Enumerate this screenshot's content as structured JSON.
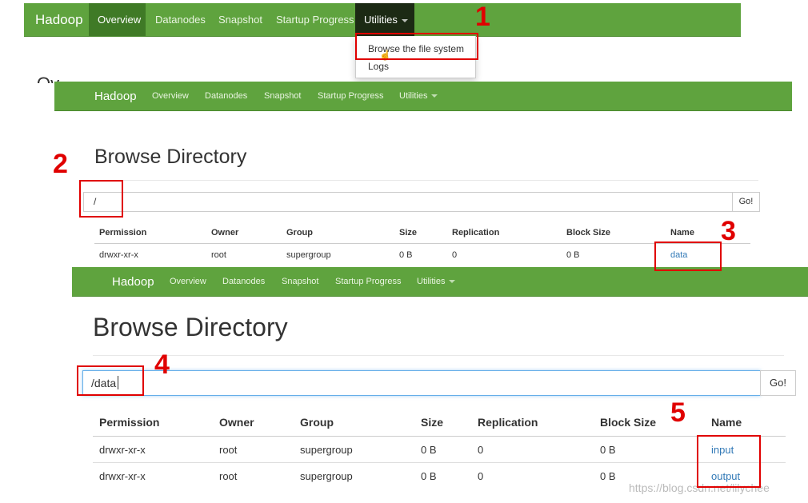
{
  "nav": {
    "brand": "Hadoop",
    "items": [
      "Overview",
      "Datanodes",
      "Snapshot",
      "Startup Progress",
      "Utilities"
    ]
  },
  "dropdown": {
    "items": [
      "Browse the file system",
      "Logs"
    ]
  },
  "browse": {
    "title": "Browse Directory",
    "go_label": "Go!",
    "columns": [
      "Permission",
      "Owner",
      "Group",
      "Size",
      "Replication",
      "Block Size",
      "Name"
    ]
  },
  "panel2": {
    "path": "/",
    "rows": [
      [
        "drwxr-xr-x",
        "root",
        "supergroup",
        "0 B",
        "0",
        "0 B",
        "data"
      ]
    ]
  },
  "panel3": {
    "path": "/data",
    "rows": [
      [
        "drwxr-xr-x",
        "root",
        "supergroup",
        "0 B",
        "0",
        "0 B",
        "input"
      ],
      [
        "drwxr-xr-x",
        "root",
        "supergroup",
        "0 B",
        "0",
        "0 B",
        "output"
      ]
    ]
  },
  "steps": [
    "1",
    "2",
    "3",
    "4",
    "5"
  ],
  "watermark": "https://blog.csdn.net/lilychee",
  "colors": {
    "navbar": "#5fa33e",
    "active_overview": "#3f7a26",
    "active_utilities": "#1c2a14",
    "annotation": "#e00000",
    "link": "#337ab7"
  }
}
